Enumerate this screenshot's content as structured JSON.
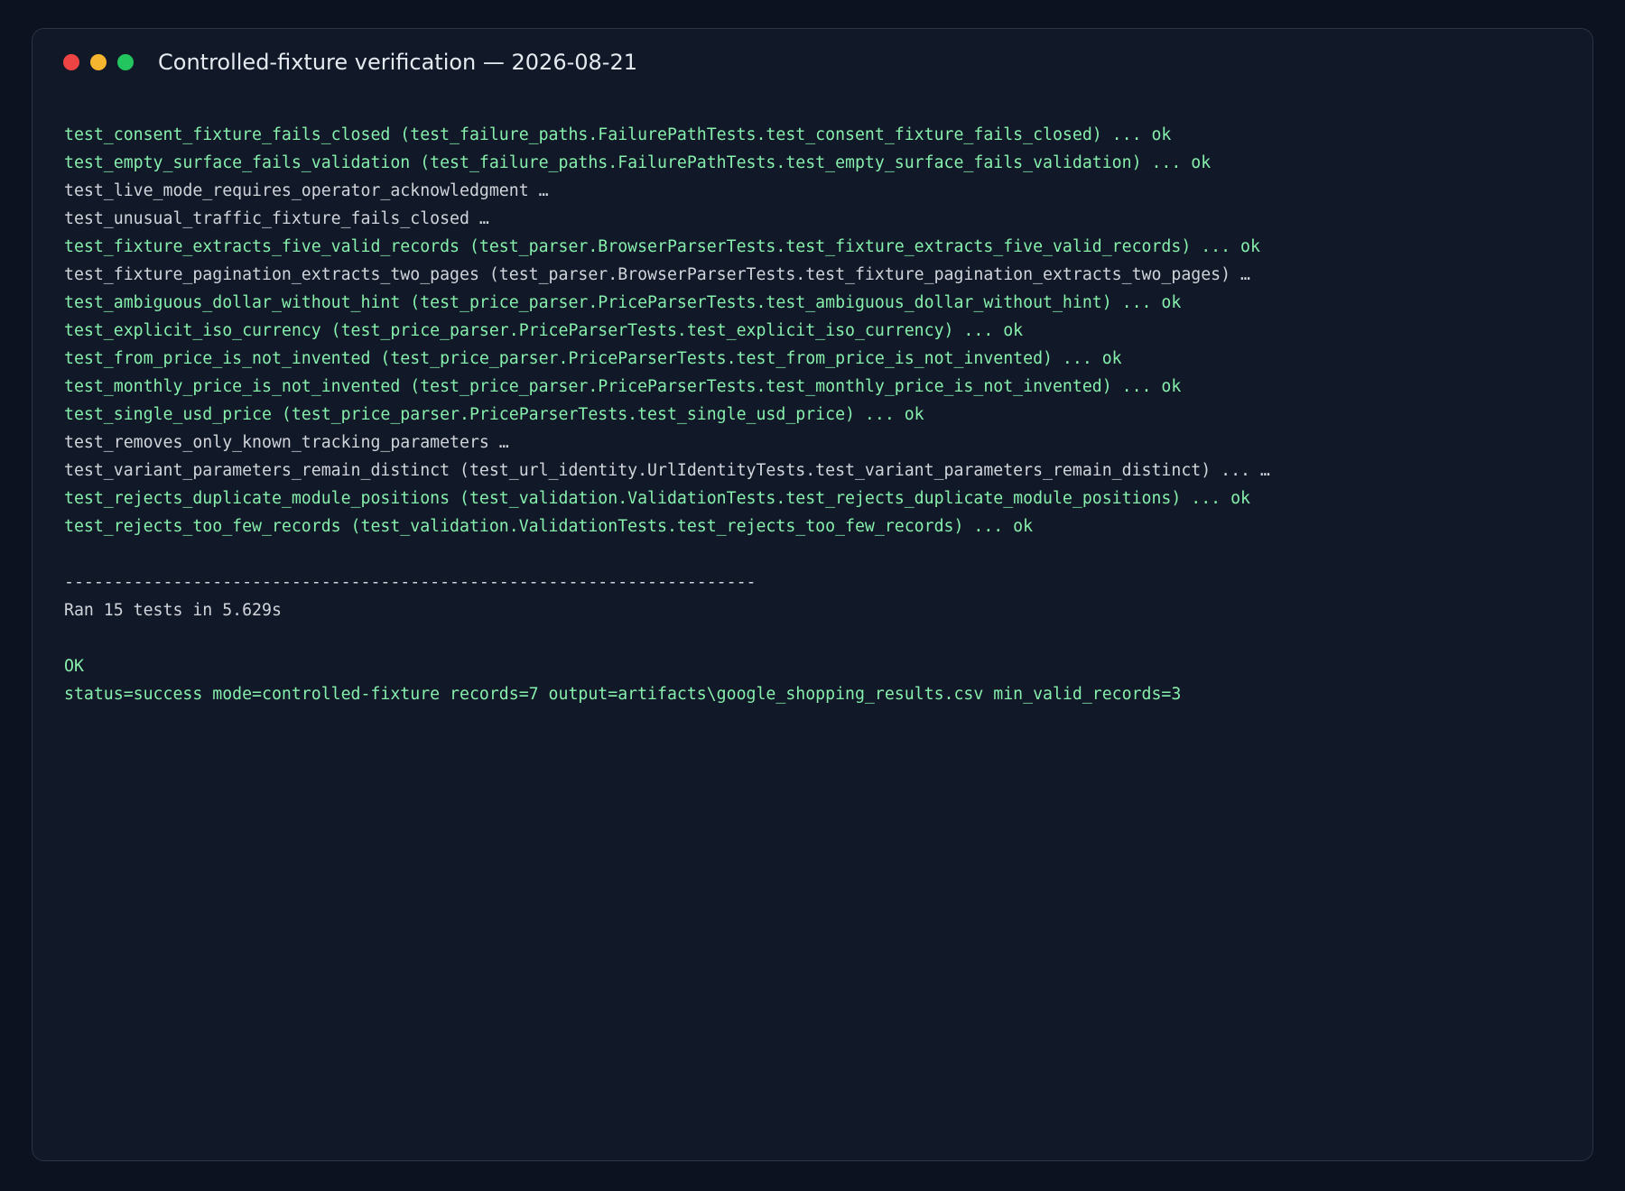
{
  "window": {
    "title": "Controlled-fixture verification — 2026-08-21",
    "traffic_lights": {
      "close_color": "#ef4444",
      "minimize_color": "#f5b52e",
      "maximize_color": "#22c55e"
    }
  },
  "colors": {
    "window_background": "#111827",
    "page_background": "#0c121f",
    "success_text": "#86efac",
    "plain_text": "#d1d5db"
  },
  "output": {
    "lines": [
      {
        "text": "test_consent_fixture_fails_closed (test_failure_paths.FailurePathTests.test_consent_fixture_fails_closed) ... ok",
        "status": "ok"
      },
      {
        "text": "test_empty_surface_fails_validation (test_failure_paths.FailurePathTests.test_empty_surface_fails_validation) ... ok",
        "status": "ok"
      },
      {
        "text": "test_live_mode_requires_operator_acknowledgment …",
        "status": "plain"
      },
      {
        "text": "test_unusual_traffic_fixture_fails_closed …",
        "status": "plain"
      },
      {
        "text": "test_fixture_extracts_five_valid_records (test_parser.BrowserParserTests.test_fixture_extracts_five_valid_records) ... ok",
        "status": "ok"
      },
      {
        "text": "test_fixture_pagination_extracts_two_pages (test_parser.BrowserParserTests.test_fixture_pagination_extracts_two_pages) …",
        "status": "plain"
      },
      {
        "text": "test_ambiguous_dollar_without_hint (test_price_parser.PriceParserTests.test_ambiguous_dollar_without_hint) ... ok",
        "status": "ok"
      },
      {
        "text": "test_explicit_iso_currency (test_price_parser.PriceParserTests.test_explicit_iso_currency) ... ok",
        "status": "ok"
      },
      {
        "text": "test_from_price_is_not_invented (test_price_parser.PriceParserTests.test_from_price_is_not_invented) ... ok",
        "status": "ok"
      },
      {
        "text": "test_monthly_price_is_not_invented (test_price_parser.PriceParserTests.test_monthly_price_is_not_invented) ... ok",
        "status": "ok"
      },
      {
        "text": "test_single_usd_price (test_price_parser.PriceParserTests.test_single_usd_price) ... ok",
        "status": "ok"
      },
      {
        "text": "test_removes_only_known_tracking_parameters …",
        "status": "plain"
      },
      {
        "text": "test_variant_parameters_remain_distinct (test_url_identity.UrlIdentityTests.test_variant_parameters_remain_distinct) ... …",
        "status": "plain"
      },
      {
        "text": "test_rejects_duplicate_module_positions (test_validation.ValidationTests.test_rejects_duplicate_module_positions) ... ok",
        "status": "ok"
      },
      {
        "text": "test_rejects_too_few_records (test_validation.ValidationTests.test_rejects_too_few_records) ... ok",
        "status": "ok"
      },
      {
        "text": "",
        "status": "blank"
      },
      {
        "text": "----------------------------------------------------------------------",
        "status": "plain"
      },
      {
        "text": "Ran 15 tests in 5.629s",
        "status": "plain"
      },
      {
        "text": "",
        "status": "blank"
      },
      {
        "text": "OK",
        "status": "ok"
      },
      {
        "text": "status=success mode=controlled-fixture records=7 output=artifacts\\google_shopping_results.csv min_valid_records=3",
        "status": "ok"
      }
    ]
  }
}
